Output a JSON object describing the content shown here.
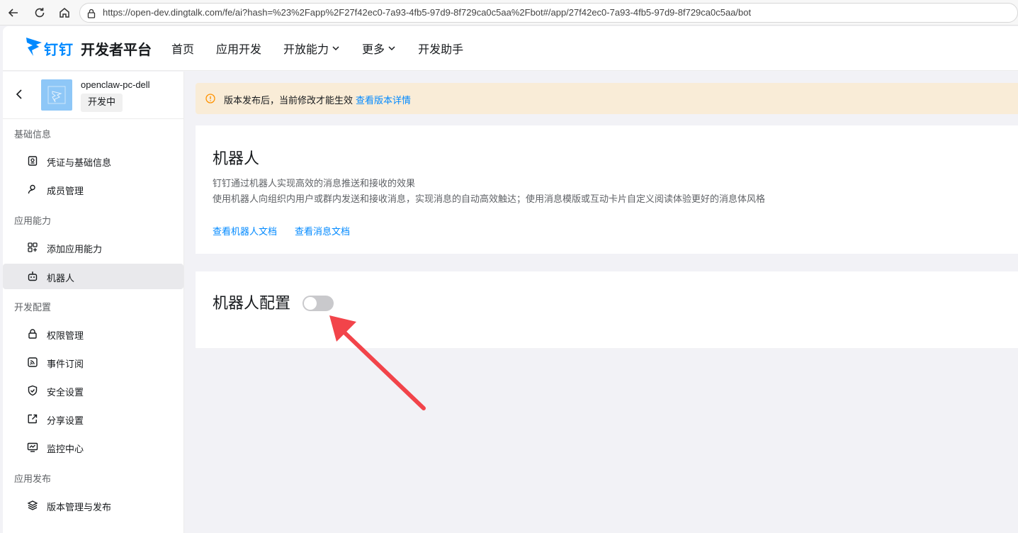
{
  "browser": {
    "url": "https://open-dev.dingtalk.com/fe/ai?hash=%23%2Fapp%2F27f42ec0-7a93-4fb5-97d9-8f729ca0c5aa%2Fbot#/app/27f42ec0-7a93-4fb5-97d9-8f729ca0c5aa/bot"
  },
  "header": {
    "logo_text": "钉钉",
    "logo_sub": "开发者平台",
    "nav": [
      {
        "label": "首页",
        "has_dropdown": false
      },
      {
        "label": "应用开发",
        "has_dropdown": false
      },
      {
        "label": "开放能力",
        "has_dropdown": true
      },
      {
        "label": "更多",
        "has_dropdown": true
      },
      {
        "label": "开发助手",
        "has_dropdown": false
      }
    ]
  },
  "sidebar": {
    "app_name": "openclaw-pc-dell",
    "app_status": "开发中",
    "groups": [
      {
        "title": "基础信息",
        "items": [
          {
            "label": "凭证与基础信息",
            "icon": "credential-icon"
          },
          {
            "label": "成员管理",
            "icon": "user-icon"
          }
        ]
      },
      {
        "title": "应用能力",
        "items": [
          {
            "label": "添加应用能力",
            "icon": "grid-add-icon"
          },
          {
            "label": "机器人",
            "icon": "robot-icon",
            "active": true
          }
        ]
      },
      {
        "title": "开发配置",
        "items": [
          {
            "label": "权限管理",
            "icon": "lock-icon"
          },
          {
            "label": "事件订阅",
            "icon": "rss-icon"
          },
          {
            "label": "安全设置",
            "icon": "shield-icon"
          },
          {
            "label": "分享设置",
            "icon": "share-icon"
          },
          {
            "label": "监控中心",
            "icon": "monitor-icon"
          }
        ]
      },
      {
        "title": "应用发布",
        "items": [
          {
            "label": "版本管理与发布",
            "icon": "layers-icon"
          }
        ]
      }
    ]
  },
  "notice": {
    "text": "版本发布后，当前修改才能生效",
    "link": "查看版本详情"
  },
  "robot_card": {
    "title": "机器人",
    "desc1": "钉钉通过机器人实现高效的消息推送和接收的效果",
    "desc2": "使用机器人向组织内用户或群内发送和接收消息，实现消息的自动高效触达；使用消息模版或互动卡片自定义阅读体验更好的消息体风格",
    "links": [
      "查看机器人文档",
      "查看消息文档"
    ]
  },
  "robot_config": {
    "title": "机器人配置",
    "toggle_on": false
  },
  "colors": {
    "brand": "#0089ff",
    "notice_bg": "#f9ecd7",
    "arrow": "#f2444a"
  }
}
